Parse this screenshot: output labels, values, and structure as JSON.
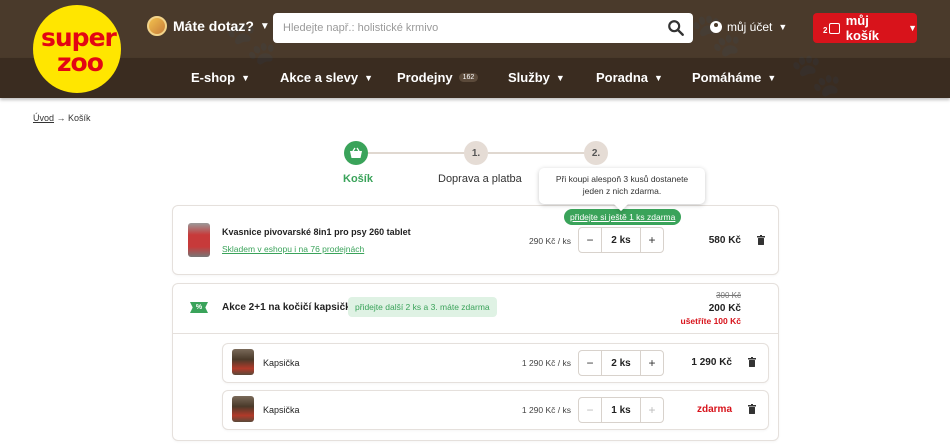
{
  "header": {
    "logo_line1": "super",
    "logo_line2": "zoo",
    "help_label": "Máte dotaz?",
    "search_placeholder": "Hledejte např.: holistické krmivo",
    "account_label": "můj účet",
    "cart_label": "můj košík",
    "cart_count": "2"
  },
  "nav": [
    {
      "label": "E-shop"
    },
    {
      "label": "Akce a slevy"
    },
    {
      "label": "Prodejny",
      "badge": "162"
    },
    {
      "label": "Služby"
    },
    {
      "label": "Poradna"
    },
    {
      "label": "Pomáháme"
    }
  ],
  "breadcrumb": {
    "home": "Úvod",
    "separator": "→",
    "current": "Košík"
  },
  "steps": [
    {
      "marker": "",
      "label": "Košík",
      "active": true
    },
    {
      "marker": "1.",
      "label": "Doprava a platba",
      "active": false
    },
    {
      "marker": "2.",
      "label": "",
      "active": false
    }
  ],
  "tooltip": {
    "line1": "Při koupi alespoň 3 kusů dostanete",
    "line2": "jeden z nich zdarma."
  },
  "item1": {
    "name": "Kvasnice pivovarské 8in1 pro psy 260 tablet",
    "stock": "Skladem v eshopu i na 76 prodejnách",
    "unit_price": "290 Kč / ks",
    "qty": "2 ks",
    "total": "580 Kč",
    "hint_prefix": "přidejte si ",
    "hint_link": "ještě 1 ks zdarma"
  },
  "promo": {
    "tag": "%",
    "title": "Akce 2+1 na kočičí kapsičky",
    "hint": "přidejte další 2 ks a 3. máte zdarma",
    "old_price": "300 Kč",
    "new_price": "200 Kč",
    "savings": "ušetříte 100 Kč",
    "items": [
      {
        "name": "Kapsička",
        "unit_price": "1 290 Kč / ks",
        "qty": "2 ks",
        "total": "1 290 Kč"
      },
      {
        "name": "Kapsička",
        "unit_price": "1 290 Kč / ks",
        "qty": "1 ks",
        "total": "zdarma"
      }
    ]
  },
  "colors": {
    "brand_red": "#d8131b",
    "brand_yellow": "#ffe600",
    "header_brown": "#4a3a2b",
    "success_green": "#3aa35a"
  }
}
